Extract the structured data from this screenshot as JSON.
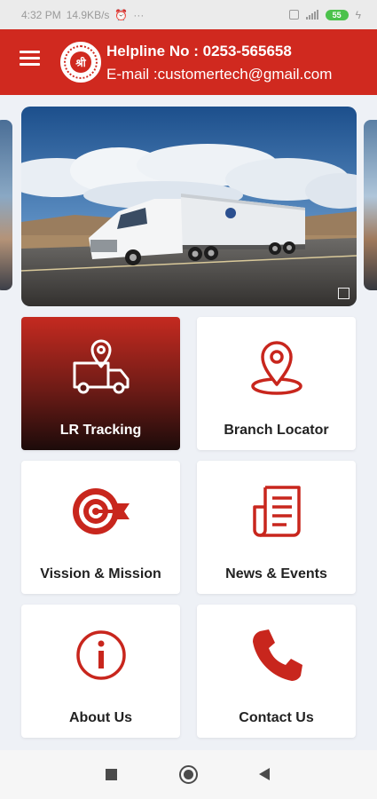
{
  "status_bar": {
    "time": "4:32 PM",
    "network_speed": "14.9KB/s",
    "more": "···",
    "battery": "55"
  },
  "header": {
    "logo_text": "श्री",
    "helpline": "Helpline No : 0253-565658",
    "email": "E-mail :customertech@gmail.com"
  },
  "colors": {
    "brand_red": "#d0291f",
    "background": "#eef1f6"
  },
  "tiles": [
    {
      "label": "LR Tracking",
      "icon": "truck-location-icon",
      "active": true
    },
    {
      "label": "Branch Locator",
      "icon": "map-pin-icon",
      "active": false
    },
    {
      "label": "Vission & Mission",
      "icon": "target-icon",
      "active": false
    },
    {
      "label": "News & Events",
      "icon": "newspaper-icon",
      "active": false
    },
    {
      "label": "About Us",
      "icon": "info-icon",
      "active": false
    },
    {
      "label": "Contact Us",
      "icon": "phone-icon",
      "active": false
    }
  ]
}
